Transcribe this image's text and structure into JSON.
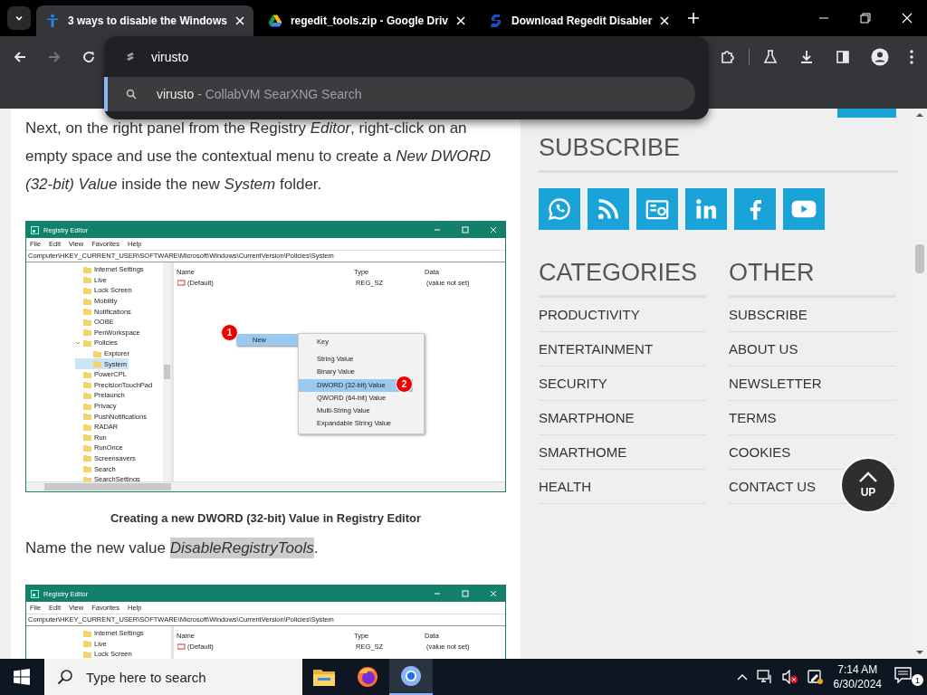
{
  "browser": {
    "tabs": [
      {
        "title": "3 ways to disable the Windows",
        "kind": "person",
        "selected": true
      },
      {
        "title": "regedit_tools.zip - Google Driv",
        "kind": "drive",
        "selected": false
      },
      {
        "title": "Download Regedit Disabler",
        "kind": "s-logo",
        "selected": false
      }
    ],
    "omnibox": {
      "value": "virusto",
      "suggestions": [
        {
          "query": "virusto",
          "source": "- CollabVM SearXNG Search",
          "selected": true
        }
      ]
    }
  },
  "article": {
    "blocks": [
      {
        "kind": "paragraph",
        "text": "Next, on the right panel from the Registry *Editor*, right-click on an empty space and use the contextual menu to create a *New DWORD (32-bit) Value* inside the new *System* folder.",
        "highlight": false
      },
      {
        "kind": "figure",
        "caption": "Creating a new DWORD (32-bit) Value in Registry Editor",
        "window": {
          "title": "Registry Editor",
          "menu": [
            "File",
            "Edit",
            "View",
            "Favorites",
            "Help"
          ],
          "path": "Computer\\HKEY_CURRENT_USER\\SOFTWARE\\Microsoft\\Windows\\CurrentVersion\\Policies\\System",
          "tree": [
            {
              "label": "Internet Settings",
              "selected": false
            },
            {
              "label": "Live",
              "selected": false
            },
            {
              "label": "Lock Screen",
              "selected": false
            },
            {
              "label": "Mobility",
              "selected": false
            },
            {
              "label": "Notifications",
              "selected": false
            },
            {
              "label": "OOBE",
              "selected": false
            },
            {
              "label": "PenWorkspace",
              "selected": false
            },
            {
              "label": "Policies",
              "selected": false,
              "expanded": true,
              "children": [
                {
                  "label": "Explorer",
                  "selected": false
                },
                {
                  "label": "System",
                  "selected": true
                }
              ]
            },
            {
              "label": "PowerCPL",
              "selected": false
            },
            {
              "label": "PrecisionTouchPad",
              "selected": false
            },
            {
              "label": "Prelaunch",
              "selected": false
            },
            {
              "label": "Privacy",
              "selected": false
            },
            {
              "label": "PushNotifications",
              "selected": false
            },
            {
              "label": "RADAR",
              "selected": false
            },
            {
              "label": "Run",
              "selected": false
            },
            {
              "label": "RunOnce",
              "selected": false
            },
            {
              "label": "Screensavers",
              "selected": false
            },
            {
              "label": "Search",
              "selected": false
            },
            {
              "label": "SearchSettings",
              "selected": false
            }
          ],
          "columns": [
            "Name",
            "Type",
            "Data"
          ],
          "values": [
            {
              "name": "(Default)",
              "type": "REG_SZ",
              "data": "(value not set)"
            }
          ],
          "context_menu": {
            "item": "New",
            "callout": "1",
            "submenu": [
              {
                "label": "Key",
                "selected": false
              },
              {
                "label": "String Value",
                "selected": false
              },
              {
                "label": "Binary Value",
                "selected": false
              },
              {
                "label": "DWORD (32-bit) Value",
                "selected": true,
                "callout": "2"
              },
              {
                "label": "QWORD (64-bit) Value",
                "selected": false
              },
              {
                "label": "Multi-String Value",
                "selected": false
              },
              {
                "label": "Expandable String Value",
                "selected": false
              }
            ]
          }
        }
      },
      {
        "kind": "paragraph",
        "text": "Name the new value *DisableRegistryTools*.",
        "highlight": true
      },
      {
        "kind": "figure",
        "window": {
          "title": "Registry Editor",
          "menu": [
            "File",
            "Edit",
            "View",
            "Favorites",
            "Help"
          ],
          "path": "Computer\\HKEY_CURRENT_USER\\SOFTWARE\\Microsoft\\Windows\\CurrentVersion\\Policies\\System",
          "tree": [
            {
              "label": "Internet Settings",
              "selected": false
            },
            {
              "label": "Live",
              "selected": false
            },
            {
              "label": "Lock Screen",
              "selected": false
            }
          ],
          "columns": [
            "Name",
            "Type",
            "Data"
          ],
          "values": [
            {
              "name": "(Default)",
              "type": "REG_SZ",
              "data": "(value not set)"
            }
          ]
        }
      }
    ]
  },
  "sidebar": {
    "subscribe": {
      "heading": "SUBSCRIBE",
      "links": [
        {
          "kind": "whatsapp"
        },
        {
          "kind": "rss"
        },
        {
          "kind": "news"
        },
        {
          "kind": "linkedin"
        },
        {
          "kind": "facebook"
        },
        {
          "kind": "youtube"
        }
      ]
    },
    "columns": [
      {
        "heading": "CATEGORIES",
        "items": [
          "PRODUCTIVITY",
          "ENTERTAINMENT",
          "SECURITY",
          "SMARTPHONE",
          "SMARTHOME",
          "HEALTH"
        ]
      },
      {
        "heading": "OTHER",
        "items": [
          "SUBSCRIBE",
          "ABOUT US",
          "NEWSLETTER",
          "TERMS",
          "COOKIES",
          "CONTACT US"
        ]
      }
    ]
  },
  "up_button": {
    "label": "UP"
  },
  "taskbar": {
    "search_placeholder": "Type here to search",
    "apps": [
      {
        "kind": "explorer",
        "active": false
      },
      {
        "kind": "firefox",
        "active": false
      },
      {
        "kind": "chrome",
        "active": true
      }
    ],
    "time": "7:14 AM",
    "date": "6/30/2024",
    "notification_count": "1"
  }
}
